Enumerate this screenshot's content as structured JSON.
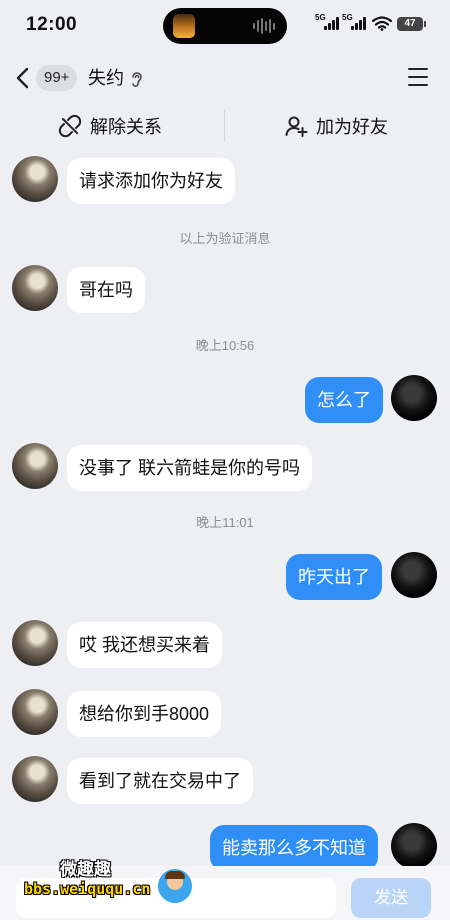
{
  "status_bar": {
    "time": "12:00",
    "signal1_label": "5G",
    "signal2_label": "5G",
    "battery": "47"
  },
  "nav": {
    "unread_badge": "99+",
    "title": "失约",
    "back_icon": "chevron-left-icon",
    "menu_icon": "hamburger-menu-icon"
  },
  "actions": {
    "remove": "解除关系",
    "add_friend": "加为好友"
  },
  "messages": [
    {
      "from": "them",
      "text": "请求添加你为好友"
    },
    {
      "type": "system",
      "text": "以上为验证消息"
    },
    {
      "from": "them",
      "text": "哥在吗"
    },
    {
      "type": "time",
      "text": "晚上10:56"
    },
    {
      "from": "me",
      "text": "怎么了"
    },
    {
      "from": "them",
      "text": "没事了 联六箭蛙是你的号吗"
    },
    {
      "type": "time",
      "text": "晚上11:01"
    },
    {
      "from": "me",
      "text": "昨天出了"
    },
    {
      "from": "them",
      "text": "哎 我还想买来着"
    },
    {
      "from": "them",
      "text": "想给你到手8000"
    },
    {
      "from": "them",
      "text": "看到了就在交易中了"
    },
    {
      "from": "me",
      "text": "能卖那么多不知道"
    }
  ],
  "input": {
    "value": "",
    "send_label": "发送"
  },
  "watermark": {
    "title": "微趣趣",
    "url": "bbs.weiququ.cn"
  },
  "colors": {
    "background": "#eeeff3",
    "my_bubble": "#2f8ff6",
    "their_bubble": "#ffffff",
    "send_disabled": "#b8d4f7"
  }
}
